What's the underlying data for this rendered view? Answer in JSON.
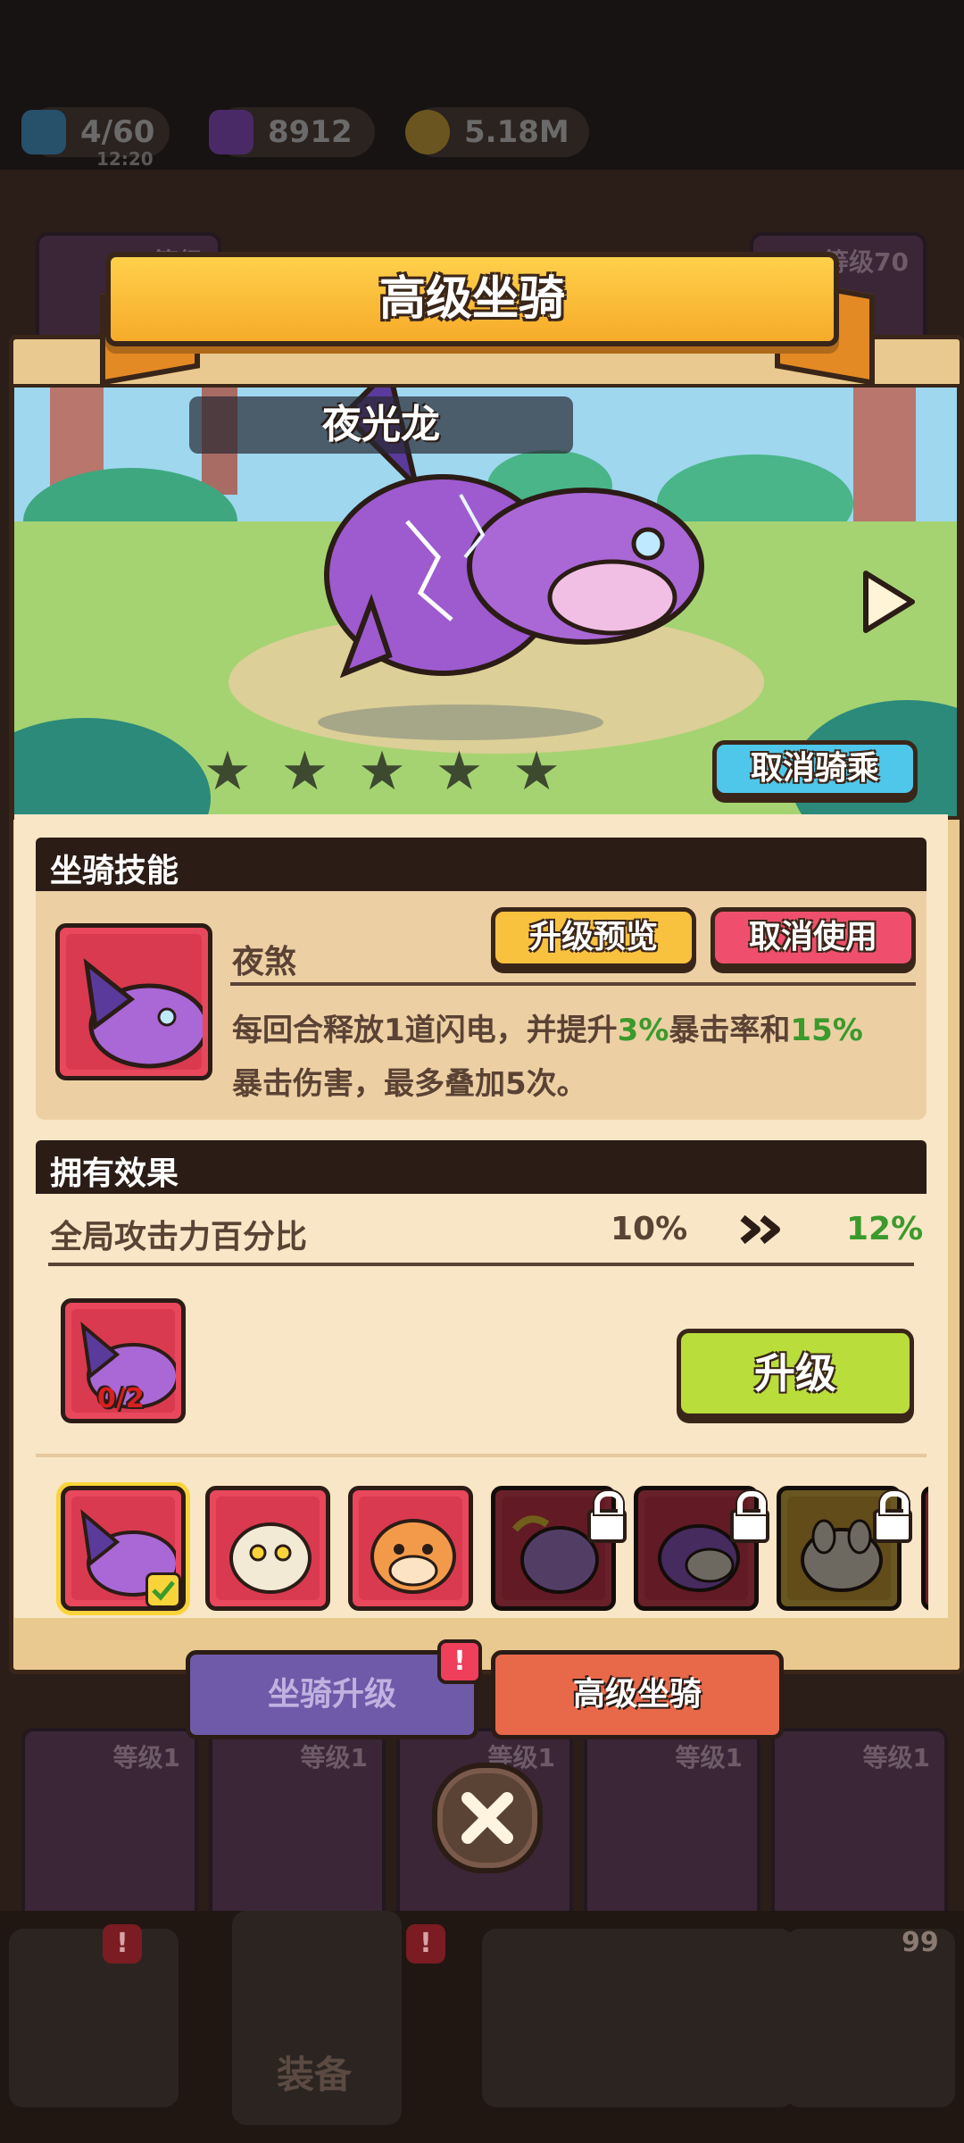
{
  "resources": {
    "energy": "4/60",
    "energy_timer": "12:20",
    "gems": "8912",
    "gold": "5.18M"
  },
  "background": {
    "top_slots": [
      "等级",
      "等级70"
    ],
    "slot_levels": [
      "等级1",
      "等级1",
      "等级1",
      "等级1",
      "等级1"
    ],
    "nav_label": "装备",
    "nav_badge_count": "99"
  },
  "modal": {
    "title": "高级坐骑",
    "mount_name": "夜光龙",
    "stars_filled": 5,
    "cancel_ride_label": "取消骑乘",
    "skill_section": {
      "header": "坐骑技能",
      "skill_name": "夜煞",
      "preview_label": "升级预览",
      "cancel_use_label": "取消使用",
      "desc_part1": "每回合释放1道闪电，并提升",
      "crit_rate": "3%",
      "desc_part2": "暴击率和",
      "crit_damage": "15%",
      "desc_line2": "暴击伤害，最多叠加5次。"
    },
    "owned_section": {
      "header": "拥有效果",
      "stat_label": "全局攻击力百分比",
      "current_value": "10%",
      "next_value": "12%",
      "shard_count": "0/2",
      "upgrade_label": "升级"
    },
    "mounts": [
      {
        "name": "night-dragon",
        "locked": false,
        "selected": true
      },
      {
        "name": "mummy-cat",
        "locked": false,
        "selected": false
      },
      {
        "name": "sabertooth-tiger",
        "locked": false,
        "selected": false
      },
      {
        "name": "rainbow-creature",
        "locked": true,
        "selected": false
      },
      {
        "name": "purple-unicorn",
        "locked": true,
        "selected": false
      },
      {
        "name": "dog",
        "locked": true,
        "selected": false
      }
    ],
    "tabs": {
      "mount_upgrade": "坐骑升级",
      "advanced_mount": "高级坐骑",
      "alert": "!"
    }
  },
  "colors": {
    "accent_orange": "#f6ab2a",
    "upgrade_green": "#b9dd3b",
    "cancel_red": "#ef4f6c",
    "ride_blue": "#4fc7ea",
    "value_green": "#3b9a2c"
  }
}
